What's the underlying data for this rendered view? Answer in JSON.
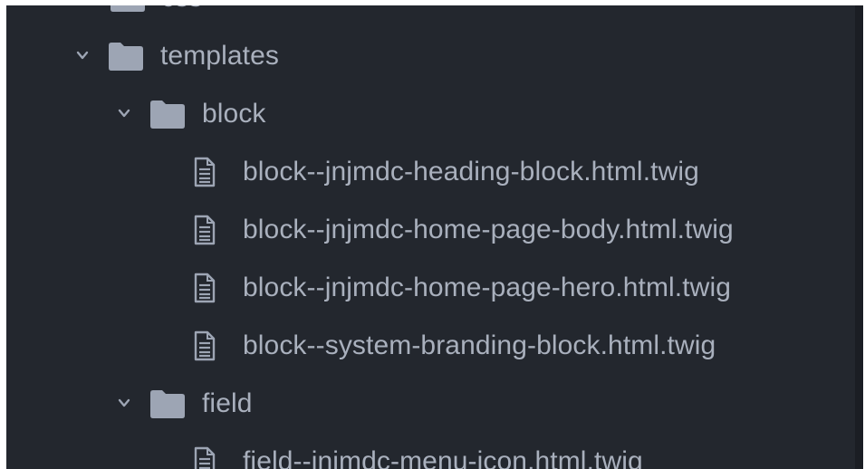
{
  "tree": {
    "partial_folder_label": "css",
    "templates": {
      "label": "templates",
      "expanded": true
    },
    "block": {
      "label": "block",
      "expanded": true,
      "files": [
        "block--jnjmdc-heading-block.html.twig",
        "block--jnjmdc-home-page-body.html.twig",
        "block--jnjmdc-home-page-hero.html.twig",
        "block--system-branding-block.html.twig"
      ]
    },
    "field": {
      "label": "field",
      "expanded": true,
      "files": [
        "field--jnjmdc-menu-icon.html.twig"
      ]
    }
  },
  "colors": {
    "background": "#23272e",
    "text": "#a9b0bd",
    "icon": "#9da5b4"
  }
}
